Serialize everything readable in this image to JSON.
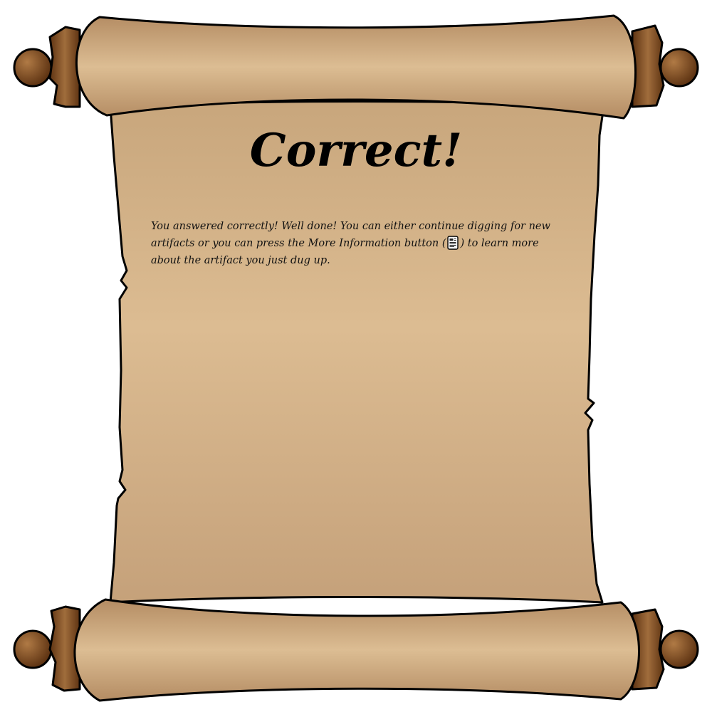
{
  "dialog": {
    "title": "Correct!",
    "message_before_icon": "You answered correctly! Well done! You can either continue digging for new artifacts or you can press the More Information button (",
    "message_after_icon": ") to learn more about the artifact you just dug up.",
    "inline_icon": "more-information-icon"
  },
  "colors": {
    "parchment_light": "#dcbc92",
    "parchment_mid": "#c9a77d",
    "parchment_dark": "#b8956a",
    "roll_light": "#d8b98f",
    "roll_dark": "#b08a63",
    "wood_dark": "#6b3d18",
    "wood_light": "#a0703f",
    "knob": "#7a4a1f",
    "outline": "#000000",
    "text": "#000000"
  }
}
